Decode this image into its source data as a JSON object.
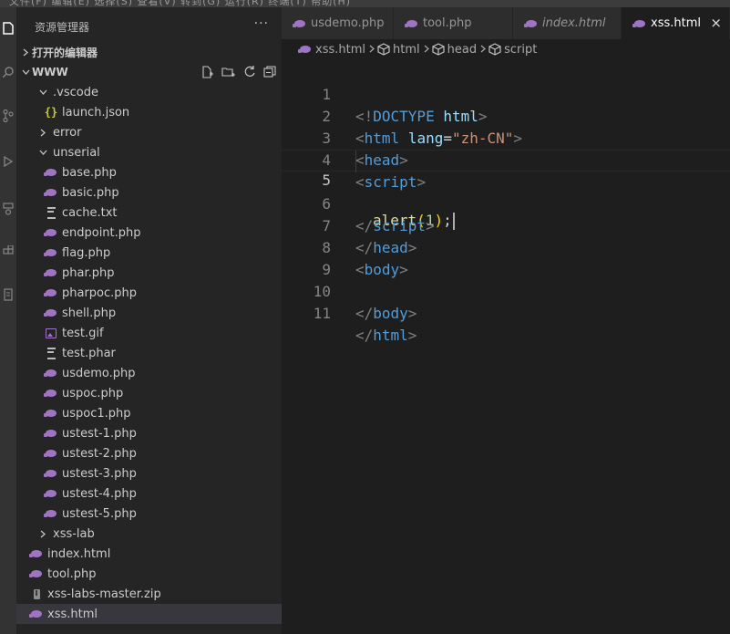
{
  "menubar": {
    "text": "文件(F)  编辑(E)  选择(S)  查看(V)  转到(G)  运行(R)  终端(T)  帮助(H)"
  },
  "explorer": {
    "title": "资源管理器",
    "more": "···",
    "open_editors": "打开的编辑器",
    "root": "WWW",
    "items": [
      {
        "label": ".vscode",
        "kind": "folder-open"
      },
      {
        "label": "launch.json",
        "kind": "json"
      },
      {
        "label": "error",
        "kind": "folder-closed"
      },
      {
        "label": "unserial",
        "kind": "folder-open"
      },
      {
        "label": "base.php",
        "kind": "php"
      },
      {
        "label": "basic.php",
        "kind": "php"
      },
      {
        "label": "cache.txt",
        "kind": "txt"
      },
      {
        "label": "endpoint.php",
        "kind": "php"
      },
      {
        "label": "flag.php",
        "kind": "php"
      },
      {
        "label": "phar.php",
        "kind": "php"
      },
      {
        "label": "pharpoc.php",
        "kind": "php"
      },
      {
        "label": "shell.php",
        "kind": "php"
      },
      {
        "label": "test.gif",
        "kind": "image"
      },
      {
        "label": "test.phar",
        "kind": "txt"
      },
      {
        "label": "usdemo.php",
        "kind": "php"
      },
      {
        "label": "uspoc.php",
        "kind": "php"
      },
      {
        "label": "uspoc1.php",
        "kind": "php"
      },
      {
        "label": "ustest-1.php",
        "kind": "php"
      },
      {
        "label": "ustest-2.php",
        "kind": "php"
      },
      {
        "label": "ustest-3.php",
        "kind": "php"
      },
      {
        "label": "ustest-4.php",
        "kind": "php"
      },
      {
        "label": "ustest-5.php",
        "kind": "php"
      },
      {
        "label": "xss-lab",
        "kind": "folder-closed"
      },
      {
        "label": "index.html",
        "kind": "php"
      },
      {
        "label": "tool.php",
        "kind": "php"
      },
      {
        "label": "xss-labs-master.zip",
        "kind": "zip"
      },
      {
        "label": "xss.html",
        "kind": "php"
      }
    ]
  },
  "tabs": [
    {
      "label": "usdemo.php"
    },
    {
      "label": "tool.php"
    },
    {
      "label": "index.html"
    },
    {
      "label": "xss.html"
    }
  ],
  "tab_close": "×",
  "breadcrumb": [
    "xss.html",
    "html",
    "head",
    "script"
  ],
  "editor": {
    "line_numbers": [
      "1",
      "2",
      "3",
      "4",
      "5",
      "6",
      "7",
      "8",
      "9",
      "10",
      "11"
    ],
    "l1": {
      "open": "<!",
      "doctype": "DOCTYPE",
      "html": "html",
      "close": ">"
    },
    "l2": {
      "open": "<",
      "tag": "html",
      "attr": "lang",
      "eq": "=",
      "val": "\"zh-CN\"",
      "close": ">"
    },
    "l3": {
      "open": "<",
      "tag": "head",
      "close": ">"
    },
    "l4": {
      "open": "<",
      "tag": "script",
      "close": ">"
    },
    "l5": {
      "fn": "alert",
      "lp": "(",
      "num": "1",
      "rp": ")",
      "semi": ";"
    },
    "l6": {
      "open": "</",
      "tag": "script",
      "close": ">"
    },
    "l7": {
      "open": "</",
      "tag": "head",
      "close": ">"
    },
    "l8": {
      "open": "<",
      "tag": "body",
      "close": ">"
    },
    "l10": {
      "open": "</",
      "tag": "body",
      "close": ">"
    },
    "l11": {
      "open": "</",
      "tag": "html",
      "close": ">"
    }
  },
  "colors": {
    "php_icon": "#a074c4",
    "tag": "#569cd6",
    "string": "#ce9178",
    "attribute": "#9cdcfe",
    "function": "#dcdcaa",
    "number": "#b5cea8"
  }
}
